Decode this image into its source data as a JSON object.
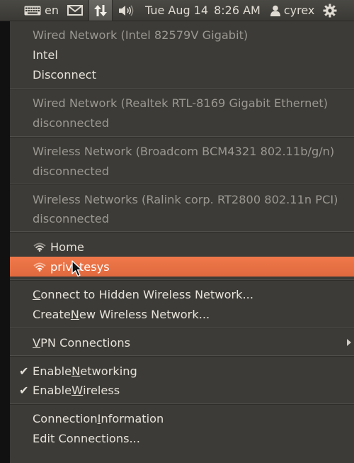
{
  "panel": {
    "keyboard_label": "en",
    "date": "Tue Aug 14",
    "time": "8:26 AM",
    "user": "cyrex"
  },
  "menu": {
    "wired1_header": "Wired Network (Intel 82579V Gigabit)",
    "wired1_conn": "Intel",
    "wired1_disconnect": "Disconnect",
    "wired2_header": "Wired Network (Realtek RTL-8169 Gigabit Ethernet)",
    "wired2_status": "disconnected",
    "wireless1_header": "Wireless Network (Broadcom BCM4321 802.11b/g/n)",
    "wireless1_status": "disconnected",
    "wireless2_header": "Wireless Networks (Ralink corp. RT2800 802.11n PCI)",
    "wireless2_status": "disconnected",
    "networks": [
      {
        "name": "Home"
      },
      {
        "name": "privatesys"
      }
    ],
    "hidden_pre": "",
    "hidden_key": "C",
    "hidden_post": "onnect to Hidden Wireless Network...",
    "create_pre": "Create ",
    "create_key": "N",
    "create_post": "ew Wireless Network...",
    "vpn_pre": "",
    "vpn_key": "V",
    "vpn_post": "PN Connections",
    "enable_net_pre": "Enable ",
    "enable_net_key": "N",
    "enable_net_post": "etworking",
    "enable_wifi_pre": "Enable ",
    "enable_wifi_key": "W",
    "enable_wifi_post": "ireless",
    "conninfo_pre": "Connection ",
    "conninfo_key": "I",
    "conninfo_post": "nformation",
    "edit_pre": "Edit Connections...",
    "check_glyph": "✔"
  },
  "colors": {
    "highlight": "#e8713f",
    "menu_bg": "#3c3b37",
    "text": "#e5e1d8",
    "dim_text": "#9b9891"
  }
}
